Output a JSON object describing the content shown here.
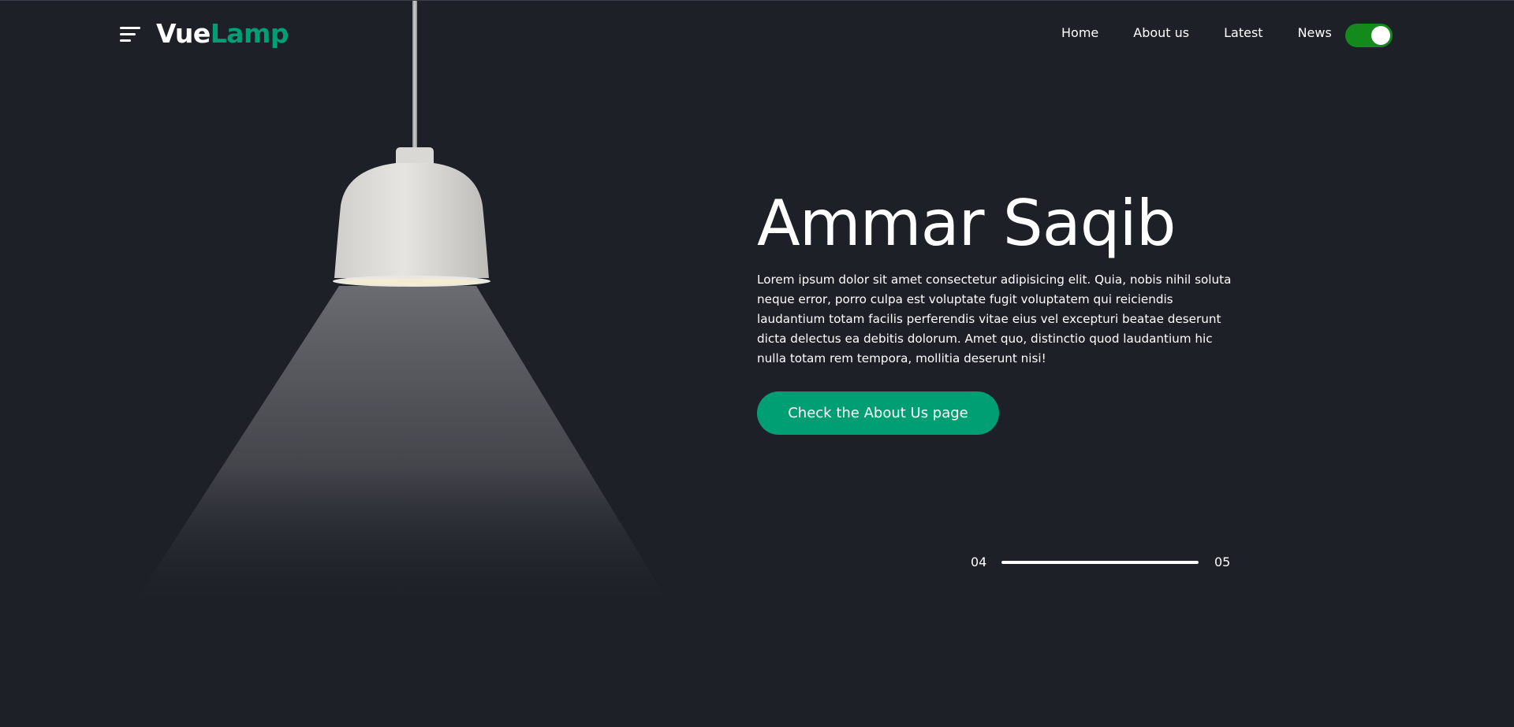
{
  "header": {
    "logo_part1": "Vue",
    "logo_part2": "Lamp",
    "nav": [
      {
        "label": "Home"
      },
      {
        "label": "About us"
      },
      {
        "label": "Latest"
      },
      {
        "label": "News"
      }
    ],
    "theme_toggle_on": true
  },
  "hero": {
    "title": "Ammar Saqib",
    "description": "Lorem ipsum dolor sit amet consectetur adipisicing elit. Quia, nobis nihil soluta neque error, porro culpa est voluptate fugit voluptatem qui reiciendis laudantium totam facilis perferendis vitae eius vel excepturi beatae deserunt dicta delectus ea debitis dolorum. Amet quo, distinctio quod laudantium hic nulla totam rem tempora, mollitia deserunt nisi!",
    "cta_label": "Check the About Us page"
  },
  "slider": {
    "current": "04",
    "total": "05",
    "progress": 1.0
  },
  "colors": {
    "background": "#1e2028",
    "accent": "#009e73",
    "toggle_on": "#138a1b",
    "text": "#ffffff"
  }
}
